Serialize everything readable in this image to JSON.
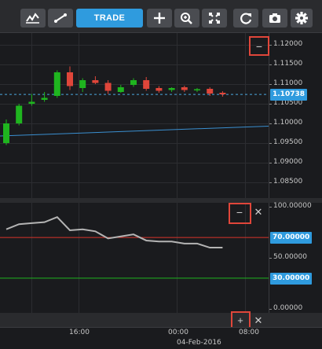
{
  "toolbar": {
    "buttons": [
      {
        "name": "indicators-button",
        "icon": "indicators-icon"
      },
      {
        "name": "drawing-tools-button",
        "icon": "trendline-icon"
      },
      {
        "name": "crosshair-button",
        "icon": "crosshair-icon"
      },
      {
        "name": "zoom-button",
        "icon": "zoom-in-icon"
      },
      {
        "name": "fullscreen-button",
        "icon": "fullscreen-icon"
      },
      {
        "name": "refresh-button",
        "icon": "refresh-icon"
      },
      {
        "name": "screenshot-button",
        "icon": "camera-icon"
      },
      {
        "name": "settings-button",
        "icon": "gear-icon"
      }
    ],
    "trade_label": "TRADE"
  },
  "price_axis": {
    "ticks": [
      "1.12000",
      "1.11500",
      "1.11000",
      "1.10500",
      "1.10000",
      "1.09500",
      "1.09000",
      "1.08500"
    ],
    "current_price": "1.10738"
  },
  "oscillator_axis": {
    "ticks": [
      "100.00000",
      "50.00000",
      "0.00000"
    ],
    "upper_level": "70.00000",
    "lower_level": "30.00000"
  },
  "time_axis": {
    "labels": [
      "16:00",
      "00:00",
      "08:00"
    ],
    "date_label": "04-Feb-2016"
  },
  "pane_controls": {
    "main_collapse": "−",
    "osc_collapse": "−",
    "osc_close": "✕",
    "bottom_expand": "+",
    "bottom_close": "✕"
  },
  "colors": {
    "accent": "#2f9bde",
    "bull": "#1fb51f",
    "bear": "#e0463a",
    "highlight": "#e0463a",
    "overbought_line": "#d9342b",
    "oversold_line": "#1fb51f",
    "trend_line": "#3a8fd0"
  },
  "chart_data": {
    "type": "candlestick",
    "series": [
      {
        "name": "",
        "values": [
          {
            "o": 1.095,
            "h": 1.101,
            "l": 1.0945,
            "c": 1.1
          },
          {
            "o": 1.1,
            "h": 1.105,
            "l": 1.0995,
            "c": 1.1045
          },
          {
            "o": 1.105,
            "h": 1.1075,
            "l": 1.1045,
            "c": 1.1055
          },
          {
            "o": 1.106,
            "h": 1.108,
            "l": 1.1055,
            "c": 1.1065
          },
          {
            "o": 1.107,
            "h": 1.1135,
            "l": 1.1065,
            "c": 1.113
          },
          {
            "o": 1.113,
            "h": 1.1145,
            "l": 1.1085,
            "c": 1.1095
          },
          {
            "o": 1.109,
            "h": 1.1115,
            "l": 1.108,
            "c": 1.111
          },
          {
            "o": 1.111,
            "h": 1.112,
            "l": 1.11,
            "c": 1.1103
          },
          {
            "o": 1.1103,
            "h": 1.111,
            "l": 1.1075,
            "c": 1.1083
          },
          {
            "o": 1.108,
            "h": 1.1098,
            "l": 1.1078,
            "c": 1.1092
          },
          {
            "o": 1.1098,
            "h": 1.1115,
            "l": 1.1093,
            "c": 1.111
          },
          {
            "o": 1.111,
            "h": 1.1118,
            "l": 1.1083,
            "c": 1.1088
          },
          {
            "o": 1.109,
            "h": 1.1095,
            "l": 1.1078,
            "c": 1.1083
          },
          {
            "o": 1.1085,
            "h": 1.1092,
            "l": 1.108,
            "c": 1.109
          },
          {
            "o": 1.1092,
            "h": 1.1096,
            "l": 1.108,
            "c": 1.1085
          },
          {
            "o": 1.1086,
            "h": 1.109,
            "l": 1.108,
            "c": 1.1087
          },
          {
            "o": 1.1088,
            "h": 1.1092,
            "l": 1.107,
            "c": 1.1076
          },
          {
            "o": 1.1078,
            "h": 1.1082,
            "l": 1.1068,
            "c": 1.1074
          }
        ]
      }
    ],
    "trend_line": [
      1.0968,
      1.0993
    ],
    "ylim": [
      1.081,
      1.123
    ],
    "oscillator": {
      "type": "line",
      "values": [
        78,
        83,
        84,
        85,
        90,
        77,
        78,
        76,
        69,
        71,
        73,
        67,
        66,
        66,
        64,
        64,
        60,
        60
      ],
      "ylim": [
        -4,
        104
      ],
      "levels": [
        70,
        30
      ]
    }
  }
}
